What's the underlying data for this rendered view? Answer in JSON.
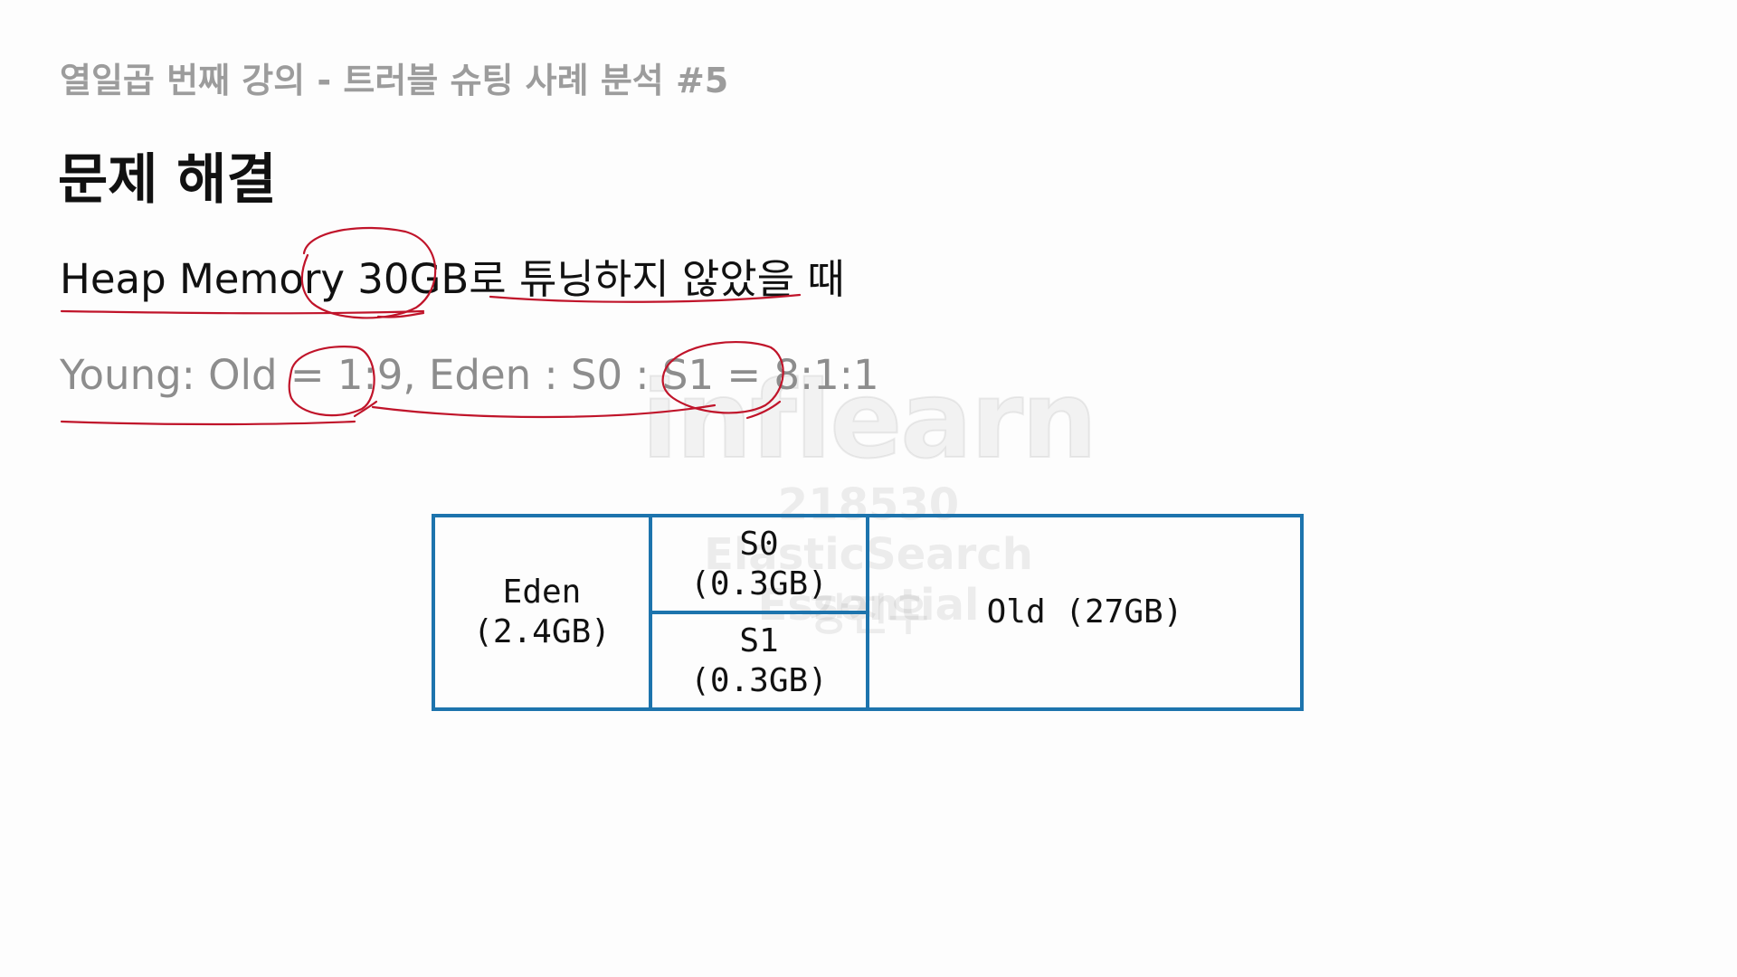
{
  "lecture_title": "열일곱 번째 강의 - 트러블 슈팅 사례 분석 #5",
  "page_title": "문제 해결",
  "heap_line": "Heap Memory 30GB로 튜닝하지 않았을 때",
  "ratio_line": "Young: Old = 1:9, Eden : S0 : S1 = 8:1:1",
  "diagram": {
    "eden": "Eden\n(2.4GB)",
    "s0": "S0\n(0.3GB)",
    "s1": "S1\n(0.3GB)",
    "old": "Old (27GB)"
  },
  "watermark": {
    "logo": "inflearn",
    "id": "218530",
    "course": "ElasticSearch Essential",
    "name": "강진우"
  },
  "colors": {
    "diagram_border": "#1d74ad",
    "annotation_ink": "#c0142a",
    "subtitle_gray": "#9c9c9c"
  }
}
